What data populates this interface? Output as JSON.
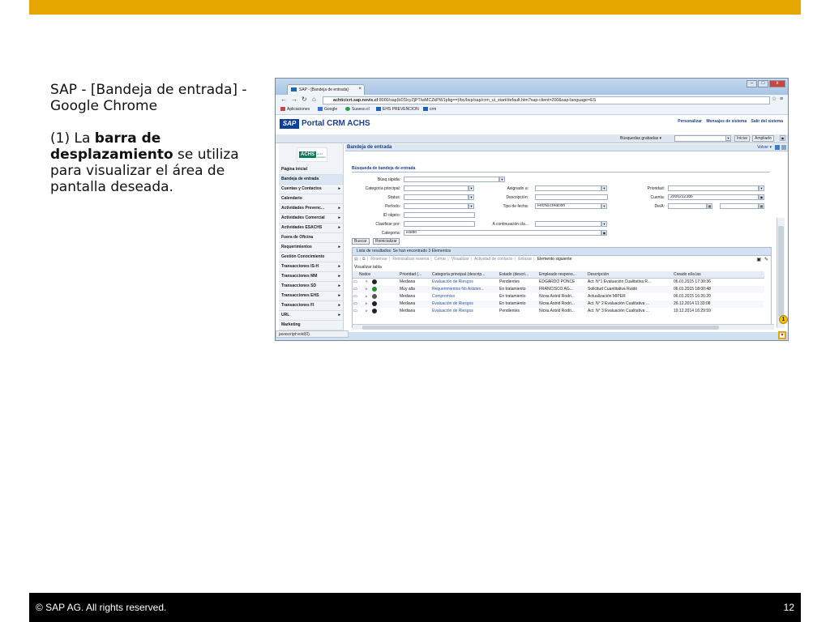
{
  "slide": {
    "caption_title": "SAP - [Bandeja de entrada] - Google Chrome",
    "caption_p2_prefix": "(1) La ",
    "caption_p2_bold": "barra de desplazamiento",
    "caption_p2_suffix": " se utiliza para visualizar el área de pantalla deseada.",
    "footer_copyright": "©  SAP AG. All rights reserved.",
    "page_number": "12",
    "accent_color": "#e6a800"
  },
  "browser": {
    "tab_title": "SAP - [Bandeja de entrada]",
    "tab_close": "×",
    "win_min": "–",
    "win_max": "□",
    "win_close": "x",
    "url_host": "achticicrt.sap.novis.cl",
    "url_rest": ":8000/sap(bD1lcyZjPTIwMCZkPW1pbg==)/bc/bsp/sap/crm_ui_start/default.htm?sap-client=200&sap-language=ES",
    "bookmarks": [
      "Aplicaciones",
      "Google",
      "Suseso.cl",
      "EHS PREVENCION",
      "crm"
    ],
    "status_text": "javascript:void(0)"
  },
  "portal": {
    "logo": "SAP",
    "title": "Portal CRM ACHS",
    "links": [
      "Personalizar",
      "Mensajes de sistema",
      "Salir del sistema"
    ],
    "saved_searches_label": "Búsquedas grabadas ▾",
    "btn_start": "Iniciar",
    "btn_extended": "Ampliado",
    "achs_logo": "ACHS",
    "achs_logo_small": "en el corazón"
  },
  "nav": {
    "items": [
      {
        "label": "Página inicial",
        "arrow": ""
      },
      {
        "label": "Bandeja de entrada",
        "arrow": ""
      },
      {
        "label": "Cuentas y Contactos",
        "arrow": "▸"
      },
      {
        "label": "Calendario",
        "arrow": ""
      },
      {
        "label": "Actividades Prevenc...",
        "arrow": "▸"
      },
      {
        "label": "Actividades Comercial",
        "arrow": "▸"
      },
      {
        "label": "Actividades ESACHS",
        "arrow": "▸"
      },
      {
        "label": "Fuera de Oficina",
        "arrow": ""
      },
      {
        "label": "Requerimientos",
        "arrow": "▸"
      },
      {
        "label": "Gestión Conocimiento",
        "arrow": ""
      },
      {
        "label": "Transacciones IS-H",
        "arrow": "▸"
      },
      {
        "label": "Transacciones MM",
        "arrow": "▸"
      },
      {
        "label": "Transacciones SD",
        "arrow": "▸"
      },
      {
        "label": "Transacciones EHS",
        "arrow": "▸"
      },
      {
        "label": "Transacciones FI",
        "arrow": "▸"
      },
      {
        "label": "URL",
        "arrow": "▸"
      },
      {
        "label": "Marketing",
        "arrow": ""
      }
    ]
  },
  "inbox": {
    "title": "Bandeja de entrada",
    "volver": "Volver ▾",
    "search_title": "Búsqueda de bandeja de entrada",
    "labels": {
      "quick": "Búsq.rápida:",
      "main_cat": "Categoría principal:",
      "status": "Status:",
      "period": "Período:",
      "object_id": "ID objeto:",
      "classify": "Clasificar por:",
      "category": "Categoría:",
      "assigned": "Asignado a:",
      "description": "Descripción:",
      "date_type": "Tipo de fecha:",
      "continue": "A continuación cla...",
      "priority": "Prioridad:",
      "account": "Cuenta:",
      "from_to": "De/A:"
    },
    "values": {
      "date_type": "Fecha creación",
      "account": "2000212386",
      "category": "Ruido"
    },
    "btn_search": "Buscar",
    "btn_reset": "Reinicializar"
  },
  "results": {
    "header": "Lista de resultados: Se han encontrado 3 Elementos",
    "toolbar": [
      "Reservar",
      "Reinicializar reserva",
      "Cerrar",
      "Visualizar",
      "Actividad de contacto",
      "Enlazar",
      "Elemento siguiente"
    ],
    "view_table": "Visualizar tabla",
    "columns": [
      "Nodos",
      "Prioridad (...",
      "Categoría principal (descrip...",
      "Estado (descri...",
      "Empleado respons...",
      "Descripción",
      "Creado el/a las"
    ],
    "rows": [
      {
        "node": "▿",
        "priority": "Mediana",
        "category": "Evaluación de Riesgos",
        "status": "Pendientes",
        "employee": "EDGARDO PONCE",
        "description": "Act. N°1 Evaluación Cualitativa R...",
        "created": "06.01.2015 17:30:36"
      },
      {
        "node": "▹",
        "priority": "Muy alta",
        "category": "Requerimientos No Asisten...",
        "status": "En tratamiento",
        "employee": "FRANCISCO AG...",
        "description": "Solicitud Cuantitativa Ruido",
        "created": "06.01.2015 18:00:48"
      },
      {
        "node": "▹",
        "priority": "Mediana",
        "category": "Compromiso",
        "status": "En tratamiento",
        "employee": "Nicxa Astrid Rodri...",
        "description": "Actualización MIPER",
        "created": "06.01.2015 16:26:20"
      },
      {
        "node": "▹",
        "priority": "Mediana",
        "category": "Evaluación de Riesgos",
        "status": "En tratamiento",
        "employee": "Nicxa Astrid Rodri...",
        "description": "Act. N° 2 Evaluación Cualitativa ...",
        "created": "26.12.2014 11:33:08"
      },
      {
        "node": "▹",
        "priority": "Mediana",
        "category": "Evaluación de Riesgos",
        "status": "Pendientes",
        "employee": "Nicxa Astrid Rodri...",
        "description": "Act. N° 3 Evaluación Cualitativa ...",
        "created": "19.12.2014 16:29:59"
      }
    ]
  },
  "marker": "1",
  "scroll_down_glyph": "▾"
}
